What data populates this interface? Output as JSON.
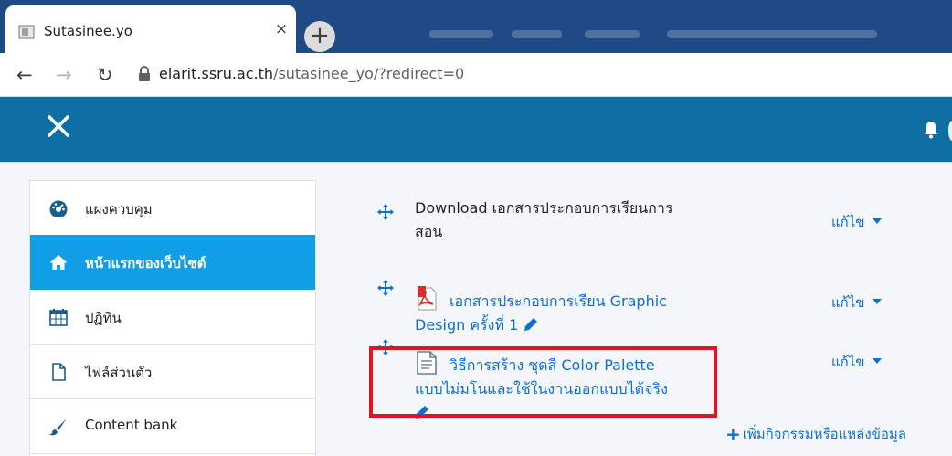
{
  "browser": {
    "tab_title": "Sutasinee.yo",
    "tab_close": "×",
    "new_tab": "+",
    "url_host": "elarit.ssru.ac.th",
    "url_path": "/sutasinee_yo/?redirect=0",
    "nav": {
      "back": "←",
      "forward": "→",
      "reload": "↻"
    }
  },
  "header": {
    "close_icon": "✕"
  },
  "sidebar": {
    "items": [
      {
        "label": "แผงควบคุม",
        "icon": "dashboard-icon",
        "active": false
      },
      {
        "label": "หน้าแรกของเว็บไซต์",
        "icon": "home-icon",
        "active": true
      },
      {
        "label": "ปฏิทิน",
        "icon": "calendar-icon",
        "active": false
      },
      {
        "label": "ไฟล์ส่วนตัว",
        "icon": "file-icon",
        "active": false
      },
      {
        "label": "Content bank",
        "icon": "brush-icon",
        "active": false
      }
    ]
  },
  "main": {
    "activities": [
      {
        "line1": "Download เอกสารประกอบการเรียนการ",
        "line2": "สอน",
        "edit": "แก้ไข"
      },
      {
        "line1": "เอกสารประกอบการเรียน Graphic",
        "line2": "Design ครั้งที่ 1",
        "edit": "แก้ไข"
      },
      {
        "line1": "วิธีการสร้าง ชุดสี Color Palette",
        "line2": "แบบไม่มโนและใช้ในงานออกแบบได้จริง",
        "edit": "แก้ไข"
      }
    ],
    "add_activity": "เพิ่มกิจกรรมหรือแหล่งข้อมูล"
  },
  "colors": {
    "header": "#0f6fa3",
    "active_nav": "#109ee6",
    "link": "#0f6fcf",
    "highlight": "#e81123",
    "tabstrip": "#1f4a86"
  }
}
